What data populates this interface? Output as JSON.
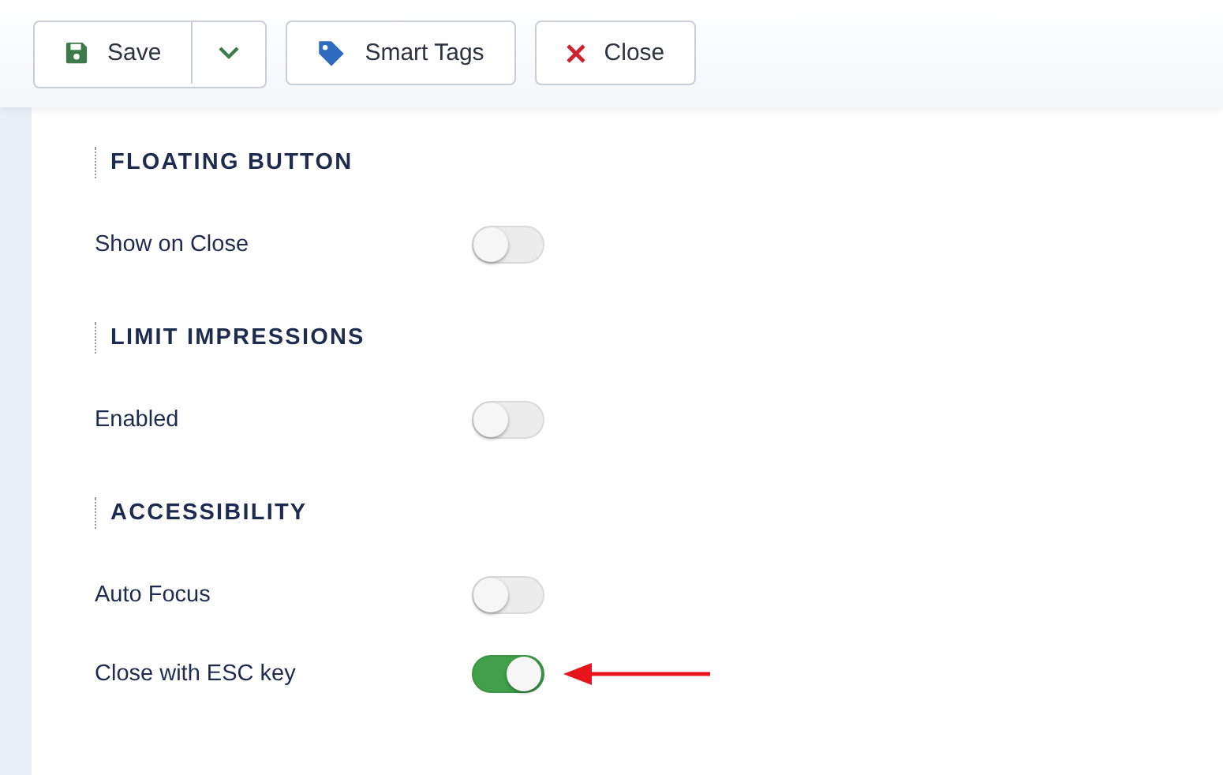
{
  "toolbar": {
    "buttons": [
      {
        "kind": "save",
        "label": "Save"
      },
      {
        "kind": "tags",
        "label": "Smart Tags"
      },
      {
        "kind": "close",
        "label": "Close"
      }
    ]
  },
  "sections": [
    {
      "title": "FLOATING BUTTON",
      "settings": [
        {
          "label": "Show on Close",
          "on": false,
          "pointed_at": false
        }
      ]
    },
    {
      "title": "LIMIT IMPRESSIONS",
      "settings": [
        {
          "label": "Enabled",
          "on": false,
          "pointed_at": false
        }
      ]
    },
    {
      "title": "ACCESSIBILITY",
      "settings": [
        {
          "label": "Auto Focus",
          "on": false,
          "pointed_at": false
        },
        {
          "label": "Close with ESC key",
          "on": true,
          "pointed_at": true
        }
      ]
    }
  ]
}
